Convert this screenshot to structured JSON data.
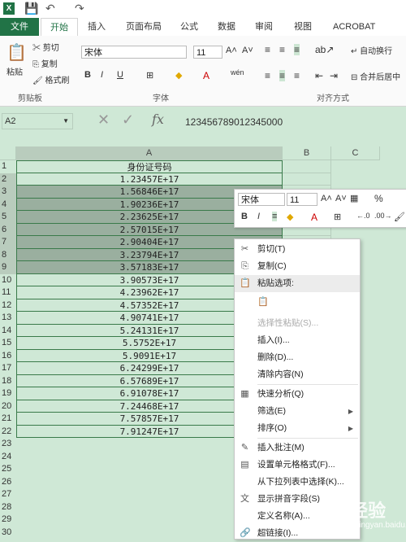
{
  "tabs": {
    "file": "文件",
    "home": "开始",
    "insert": "插入",
    "layout": "页面布局",
    "formulas": "公式",
    "data": "数据",
    "review": "审阅",
    "view": "视图",
    "acrobat": "ACROBAT"
  },
  "ribbon": {
    "paste": "粘贴",
    "cut": "剪切",
    "copy": "复制",
    "format_painter": "格式刷",
    "clipboard_group": "剪贴板",
    "font_name": "宋体",
    "font_size": "11",
    "font_group": "字体",
    "wrap": "自动换行",
    "merge": "合并后居中",
    "align_group": "对齐方式",
    "phonetic": "wén"
  },
  "formula_bar": {
    "name_box": "A2",
    "formula": "123456789012345000"
  },
  "sheet": {
    "col_headers": [
      "A",
      "B",
      "C"
    ],
    "header_cell": "身份证号码",
    "row_numbers": [
      "1",
      "2",
      "3",
      "4",
      "5",
      "6",
      "7",
      "8",
      "9",
      "10",
      "11",
      "12",
      "13",
      "14",
      "15",
      "16",
      "17",
      "18",
      "19",
      "20",
      "21",
      "22",
      "23",
      "24",
      "25",
      "26",
      "27",
      "28",
      "29",
      "30"
    ],
    "values": [
      "1.23457E+17",
      "1.56846E+17",
      "1.90236E+17",
      "2.23625E+17",
      "2.57015E+17",
      "2.90404E+17",
      "3.23794E+17",
      "3.57183E+17",
      "3.90573E+17",
      "4.23962E+17",
      "4.57352E+17",
      "4.90741E+17",
      "5.24131E+17",
      "5.5752E+17",
      "5.9091E+17",
      "6.24299E+17",
      "6.57689E+17",
      "6.91078E+17",
      "7.24468E+17",
      "7.57857E+17",
      "7.91247E+17"
    ]
  },
  "mini_toolbar": {
    "font": "宋体",
    "size": "11",
    "percent": "%"
  },
  "context_menu": [
    {
      "label": "剪切(T)",
      "icon": "scissors-icon",
      "glyph": "✂"
    },
    {
      "label": "复制(C)",
      "icon": "copy-icon",
      "glyph": "⎘"
    },
    {
      "label": "粘贴选项:",
      "icon": "paste-icon",
      "glyph": "📋"
    },
    {
      "label": "",
      "icon": "paste-option-icon",
      "glyph": "📋"
    },
    {
      "label": "选择性粘贴(S)...",
      "icon": "",
      "glyph": ""
    },
    {
      "label": "插入(I)...",
      "icon": "",
      "glyph": ""
    },
    {
      "label": "删除(D)...",
      "icon": "",
      "glyph": ""
    },
    {
      "label": "清除内容(N)",
      "icon": "",
      "glyph": ""
    },
    {
      "label": "快速分析(Q)",
      "icon": "quick-analysis-icon",
      "glyph": "▦"
    },
    {
      "label": "筛选(E)",
      "icon": "",
      "glyph": ""
    },
    {
      "label": "排序(O)",
      "icon": "",
      "glyph": ""
    },
    {
      "label": "插入批注(M)",
      "icon": "comment-icon",
      "glyph": "✎"
    },
    {
      "label": "设置单元格格式(F)...",
      "icon": "format-cells-icon",
      "glyph": "▤"
    },
    {
      "label": "从下拉列表中选择(K)...",
      "icon": "",
      "glyph": ""
    },
    {
      "label": "显示拼音字段(S)",
      "icon": "phonetic-icon",
      "glyph": "文"
    },
    {
      "label": "定义名称(A)...",
      "icon": "",
      "glyph": ""
    },
    {
      "label": "超链接(I)...",
      "icon": "hyperlink-icon",
      "glyph": "🔗"
    }
  ],
  "watermark": {
    "text": "Bai经验",
    "sub": "jingyan.baidu.com"
  },
  "colors": {
    "accent": "#217346",
    "sheet_bg": "#cfe8d6",
    "selected": "#9aaf9f"
  }
}
